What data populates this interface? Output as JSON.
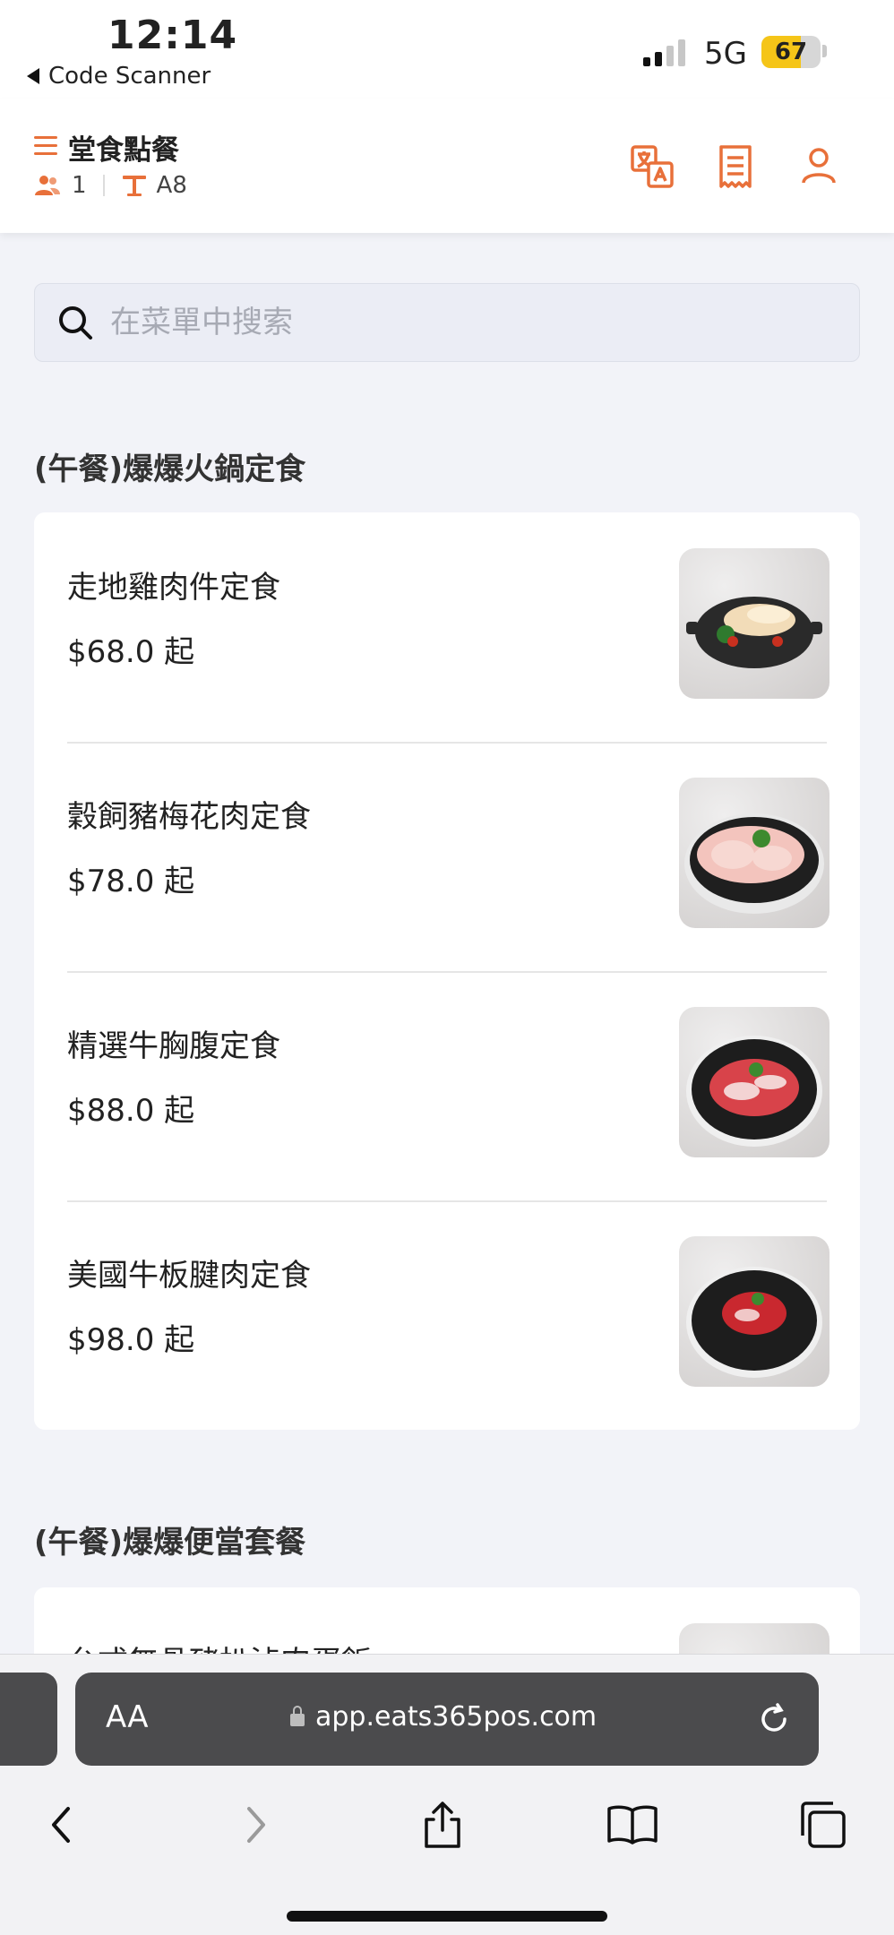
{
  "status_bar": {
    "time": "12:14",
    "back_app": "Code Scanner",
    "network": "5G",
    "battery": "67",
    "battery_level": 0.67
  },
  "header": {
    "title": "堂食點餐",
    "guests": "1",
    "table": "A8",
    "icons": [
      "menu-icon",
      "people-icon",
      "table-icon",
      "translate-icon",
      "receipt-icon",
      "user-icon"
    ]
  },
  "search": {
    "placeholder": "在菜單中搜索",
    "value": ""
  },
  "categories": [
    {
      "title": "(午餐)爆爆火鍋定食",
      "items": [
        {
          "name": "走地雞肉件定食",
          "price": "$68.0 起"
        },
        {
          "name": "穀飼豬梅花肉定食",
          "price": "$78.0 起"
        },
        {
          "name": "精選牛胸腹定食",
          "price": "$88.0 起"
        },
        {
          "name": "美國牛板腱肉定食",
          "price": "$98.0 起"
        }
      ]
    },
    {
      "title": "(午餐)爆爆便當套餐",
      "items": [
        {
          "name": "台式無骨豬扒滷肉蛋飯",
          "price": ""
        }
      ]
    }
  ],
  "browser": {
    "aa_label": "AA",
    "url": "app.eats365pos.com"
  },
  "colors": {
    "accent": "#e8703a",
    "background": "#f2f3f8"
  }
}
